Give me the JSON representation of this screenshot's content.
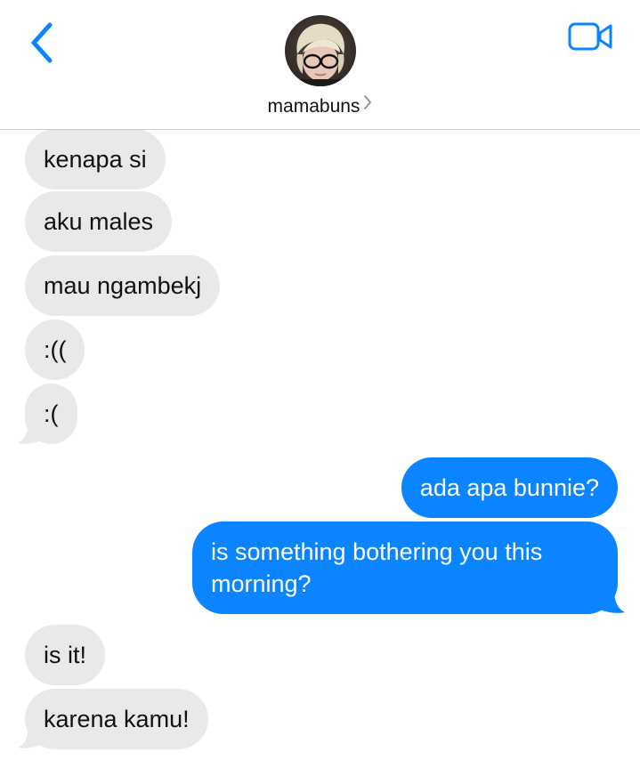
{
  "header": {
    "contact_name": "mamabuns",
    "accent_color": "#0a84ff",
    "icons": {
      "back": "chevron-left-icon",
      "video": "video-camera-icon",
      "disclosure": "chevron-right-icon"
    }
  },
  "messages": [
    {
      "direction": "received",
      "text": "kenapa si"
    },
    {
      "direction": "received",
      "text": "aku males"
    },
    {
      "direction": "received",
      "text": "mau ngambekj"
    },
    {
      "direction": "received",
      "text": ":(("
    },
    {
      "direction": "received",
      "text": ":("
    },
    {
      "direction": "sent",
      "text": "ada apa bunnie?"
    },
    {
      "direction": "sent",
      "line1": "is something bothering you this",
      "line2": "morning?"
    },
    {
      "direction": "received",
      "text": "is it!"
    },
    {
      "direction": "received",
      "text": "karena kamu!"
    }
  ],
  "colors": {
    "sent_bubble": "#0a84ff",
    "received_bubble": "#e9e9eb"
  }
}
